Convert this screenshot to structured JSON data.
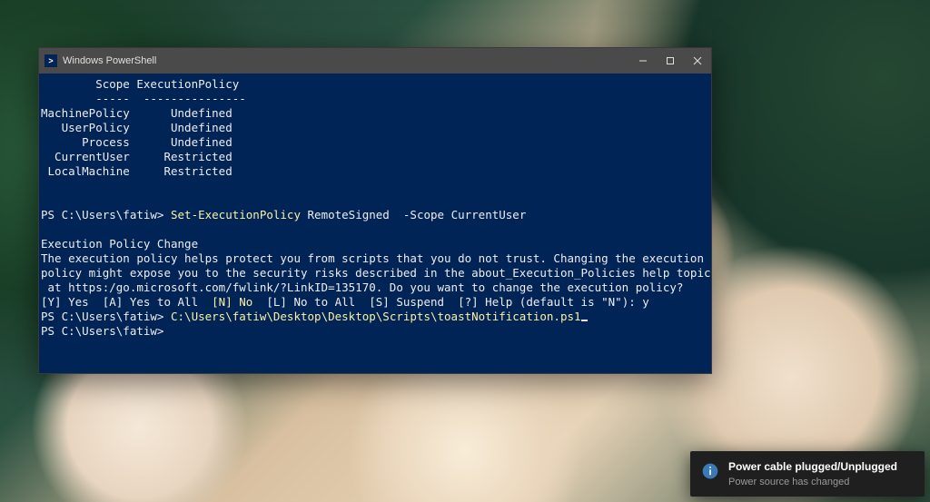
{
  "window": {
    "title": "Windows PowerShell"
  },
  "terminal": {
    "header_scope": "        Scope",
    "header_policy": " ExecutionPolicy",
    "header_rule": "        -----  ---------------",
    "rows": [
      {
        "scope": "MachinePolicy",
        "policy": "      Undefined"
      },
      {
        "scope": "   UserPolicy",
        "policy": "      Undefined"
      },
      {
        "scope": "      Process",
        "policy": "      Undefined"
      },
      {
        "scope": "  CurrentUser",
        "policy": "     Restricted"
      },
      {
        "scope": " LocalMachine",
        "policy": "     Restricted"
      }
    ],
    "prompt1_prefix": "PS C:\\Users\\fatiw> ",
    "prompt1_cmdlet": "Set-ExecutionPolicy",
    "prompt1_arg1": " RemoteSigned  ",
    "prompt1_flag": "-Scope",
    "prompt1_arg2": " CurrentUser",
    "policy_change_heading": "Execution Policy Change",
    "policy_change_body1": "The execution policy helps protect you from scripts that you do not trust. Changing the execution",
    "policy_change_body2": "policy might expose you to the security risks described in the about_Execution_Policies help topic",
    "policy_change_body3": " at https:/go.microsoft.com/fwlink/?LinkID=135170. Do you want to change the execution policy?",
    "choices_pre": "[Y] Yes  [A] Yes to All  ",
    "choices_def": "[N] No",
    "choices_post": "  [L] No to All  [S] Suspend  [?] Help (default is \"N\"): y",
    "prompt2_prefix": "PS C:\\Users\\fatiw> ",
    "prompt2_path": "C:\\Users\\fatiw\\Desktop\\Desktop\\Scripts\\toastNotification.ps1",
    "prompt3": "PS C:\\Users\\fatiw>"
  },
  "toast": {
    "title": "Power cable plugged/Unplugged",
    "message": "Power source has changed"
  }
}
